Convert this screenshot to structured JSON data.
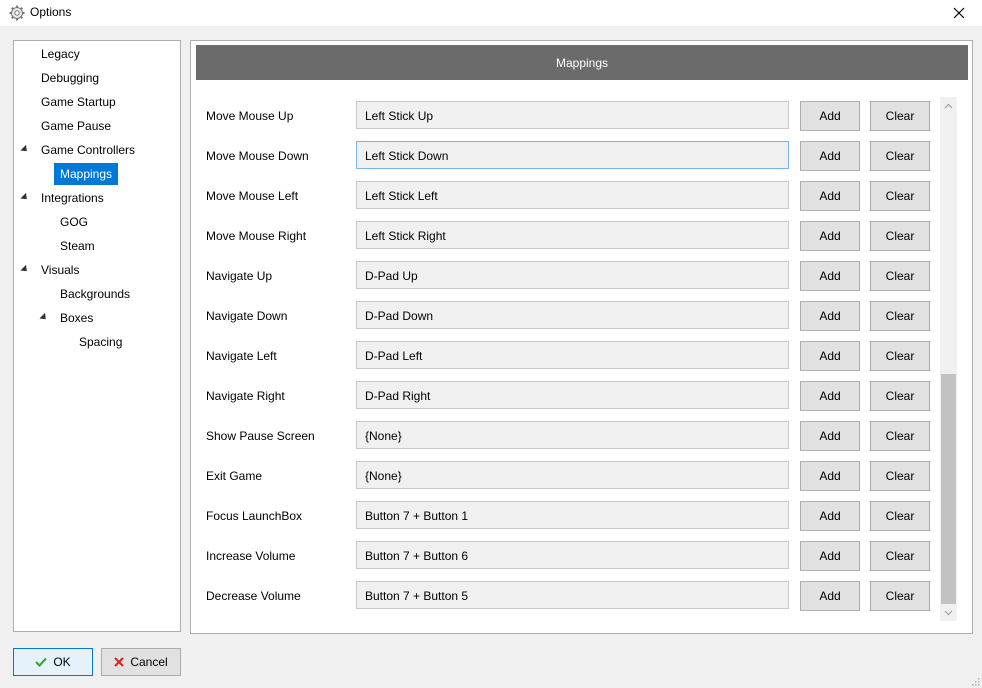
{
  "window": {
    "title": "Options",
    "icon": "gear-icon",
    "close_icon": "close-icon"
  },
  "sidebar": {
    "items": [
      {
        "label": "Legacy",
        "level": 0,
        "expandable": false
      },
      {
        "label": "Debugging",
        "level": 0,
        "expandable": false
      },
      {
        "label": "Game Startup",
        "level": 0,
        "expandable": false
      },
      {
        "label": "Game Pause",
        "level": 0,
        "expandable": false
      },
      {
        "label": "Game Controllers",
        "level": 0,
        "expandable": true,
        "expanded": true
      },
      {
        "label": "Mappings",
        "level": 1,
        "selected": true
      },
      {
        "label": "Integrations",
        "level": 0,
        "expandable": true,
        "expanded": true
      },
      {
        "label": "GOG",
        "level": 1
      },
      {
        "label": "Steam",
        "level": 1
      },
      {
        "label": "Visuals",
        "level": 0,
        "expandable": true,
        "expanded": true
      },
      {
        "label": "Backgrounds",
        "level": 1
      },
      {
        "label": "Boxes",
        "level": 1,
        "expandable": true,
        "expanded": true
      },
      {
        "label": "Spacing",
        "level": 2
      }
    ],
    "selected_color": "#0078d7"
  },
  "main": {
    "header": "Mappings",
    "add_label": "Add",
    "clear_label": "Clear",
    "mappings": [
      {
        "name": "Move Mouse Up",
        "value": "Left Stick Up"
      },
      {
        "name": "Move Mouse Down",
        "value": "Left Stick Down",
        "focused": true
      },
      {
        "name": "Move Mouse Left",
        "value": "Left Stick Left"
      },
      {
        "name": "Move Mouse Right",
        "value": "Left Stick Right"
      },
      {
        "name": "Navigate Up",
        "value": "D-Pad Up"
      },
      {
        "name": "Navigate Down",
        "value": "D-Pad Down"
      },
      {
        "name": "Navigate Left",
        "value": "D-Pad Left"
      },
      {
        "name": "Navigate Right",
        "value": "D-Pad Right"
      },
      {
        "name": "Show Pause Screen",
        "value": "{None}"
      },
      {
        "name": "Exit Game",
        "value": "{None}"
      },
      {
        "name": "Focus LaunchBox",
        "value": "Button 7 + Button 1"
      },
      {
        "name": "Increase Volume",
        "value": "Button 7 + Button 6"
      },
      {
        "name": "Decrease Volume",
        "value": "Button 7 + Button 5"
      }
    ]
  },
  "footer": {
    "ok_label": "OK",
    "cancel_label": "Cancel",
    "ok_icon": "checkmark-icon",
    "cancel_icon": "x-icon",
    "ok_color": "#3aa935",
    "cancel_color": "#d9261c"
  }
}
